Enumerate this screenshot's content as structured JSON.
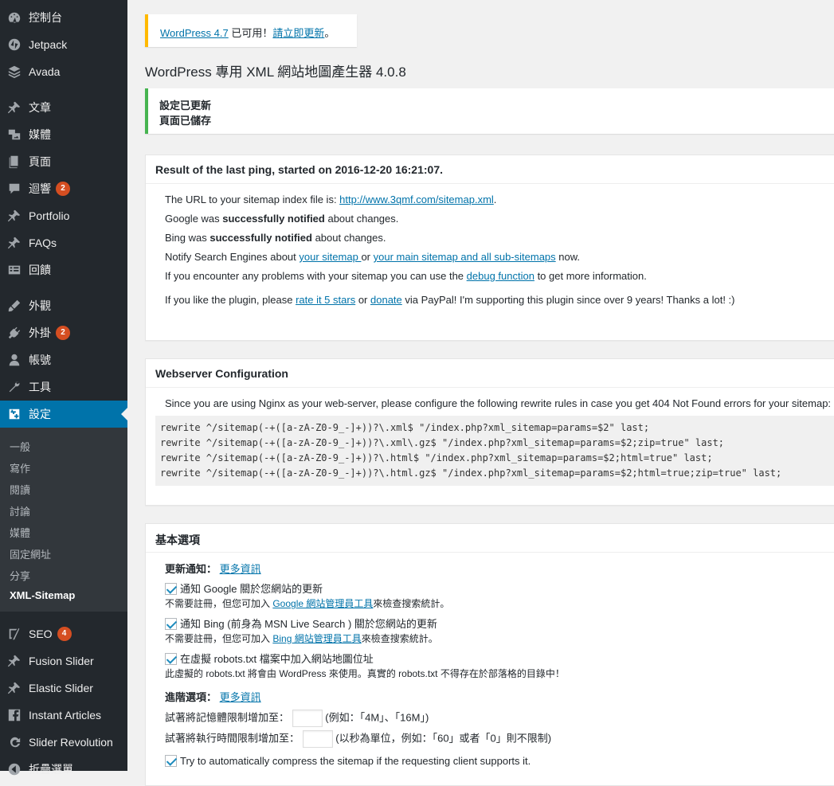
{
  "sidebar": {
    "items": [
      {
        "label": "控制台",
        "icon": "dashboard-icon"
      },
      {
        "label": "Jetpack",
        "icon": "jetpack-icon"
      },
      {
        "label": "Avada",
        "icon": "avada-icon"
      },
      {
        "label": "文章",
        "icon": "pin-icon"
      },
      {
        "label": "媒體",
        "icon": "media-icon"
      },
      {
        "label": "頁面",
        "icon": "page-icon"
      },
      {
        "label": "迴響",
        "icon": "comments-icon",
        "badge": "2"
      },
      {
        "label": "Portfolio",
        "icon": "pin-icon"
      },
      {
        "label": "FAQs",
        "icon": "pin-icon"
      },
      {
        "label": "回饋",
        "icon": "feedback-icon"
      },
      {
        "label": "外觀",
        "icon": "appearance-icon"
      },
      {
        "label": "外掛",
        "icon": "plugin-icon",
        "badge": "2"
      },
      {
        "label": "帳號",
        "icon": "user-icon"
      },
      {
        "label": "工具",
        "icon": "tools-icon"
      },
      {
        "label": "設定",
        "icon": "settings-icon"
      },
      {
        "label": "SEO",
        "icon": "seo-icon",
        "badge": "4"
      },
      {
        "label": "Fusion Slider",
        "icon": "pin-icon"
      },
      {
        "label": "Elastic Slider",
        "icon": "pin-icon"
      },
      {
        "label": "Instant Articles",
        "icon": "facebook-icon"
      },
      {
        "label": "Slider Revolution",
        "icon": "refresh-icon"
      },
      {
        "label": "折疊選單",
        "icon": "collapse-icon"
      }
    ],
    "submenu": [
      "一般",
      "寫作",
      "閱讀",
      "討論",
      "媒體",
      "固定網址",
      "分享",
      "XML-Sitemap"
    ]
  },
  "notice": {
    "update_link": "WordPress 4.7",
    "update_text": " 已可用！",
    "update_now": "請立即更新",
    "update_end": "。"
  },
  "page_title": "WordPress 專用 XML 網站地圖產生器 4.0.8",
  "saved": {
    "line1": "設定已更新",
    "line2": "頁面已儲存"
  },
  "ping": {
    "title": "Result of the last ping, started on 2016-12-20 16:21:07.",
    "url_prefix": "The URL to your sitemap index file is: ",
    "url": "http://www.3qmf.com/sitemap.xml",
    "url_suffix": ".",
    "google_pre": "Google was ",
    "google_bold": "successfully notified",
    "google_post": " about changes.",
    "bing_pre": "Bing was ",
    "bing_bold": "successfully notified",
    "bing_post": " about changes.",
    "notify_pre": "Notify Search Engines about ",
    "notify_link1": "your sitemap ",
    "notify_mid": " or ",
    "notify_link2": "your main sitemap and all sub-sitemaps",
    "notify_post": " now.",
    "debug_pre": "If you encounter any problems with your sitemap you can use the ",
    "debug_link": "debug function",
    "debug_post": " to get more information.",
    "like_pre": "If you like the plugin, please ",
    "like_link1": "rate it 5 stars",
    "like_mid": " or ",
    "like_link2": "donate",
    "like_post": " via PayPal! I'm supporting this plugin since over 9 years! Thanks a lot! :)"
  },
  "webserver": {
    "title": "Webserver Configuration",
    "intro": "Since you are using Nginx as your web-server, please configure the following rewrite rules in case you get 404 Not Found errors for your sitemap:",
    "rules": "rewrite ^/sitemap(-+([a-zA-Z0-9_-]+))?\\.xml$ \"/index.php?xml_sitemap=params=$2\" last;\nrewrite ^/sitemap(-+([a-zA-Z0-9_-]+))?\\.xml\\.gz$ \"/index.php?xml_sitemap=params=$2;zip=true\" last;\nrewrite ^/sitemap(-+([a-zA-Z0-9_-]+))?\\.html$ \"/index.php?xml_sitemap=params=$2;html=true\" last;\nrewrite ^/sitemap(-+([a-zA-Z0-9_-]+))?\\.html.gz$ \"/index.php?xml_sitemap=params=$2;html=true;zip=true\" last;"
  },
  "basic": {
    "title": "基本選項",
    "update_label": "更新通知：",
    "more_info": "更多資訊",
    "google_cb": "通知 Google 關於您網站的更新",
    "google_note_pre": "不需要註冊，但您可加入 ",
    "google_note_link": "Google 網站管理員工具",
    "google_note_post": "來檢查搜索統計。",
    "bing_cb": "通知 Bing (前身為 MSN Live Search ) 關於您網站的更新",
    "bing_note_pre": "不需要註冊，但您可加入 ",
    "bing_note_link": "Bing 網站管理員工具",
    "bing_note_post": "來檢查搜索統計。",
    "robots_cb": "在虛擬 robots.txt 檔案中加入網站地圖位址",
    "robots_note": "此虛擬的 robots.txt 將會由 WordPress 來使用。真實的 robots.txt 不得存在於部落格的目錄中！",
    "advanced_label": "進階選項：",
    "advanced_more": "更多資訊",
    "memory_label": "試著將記憶體限制增加至：",
    "memory_value": "",
    "memory_hint": "(例如：「4M」、「16M」)",
    "time_label": "試著將執行時間限制增加至：",
    "time_value": "",
    "time_hint": "(以秒為單位，例如：「60」或者「0」則不限制)",
    "compress_cb": "Try to automatically compress the sitemap if the requesting client supports it."
  }
}
